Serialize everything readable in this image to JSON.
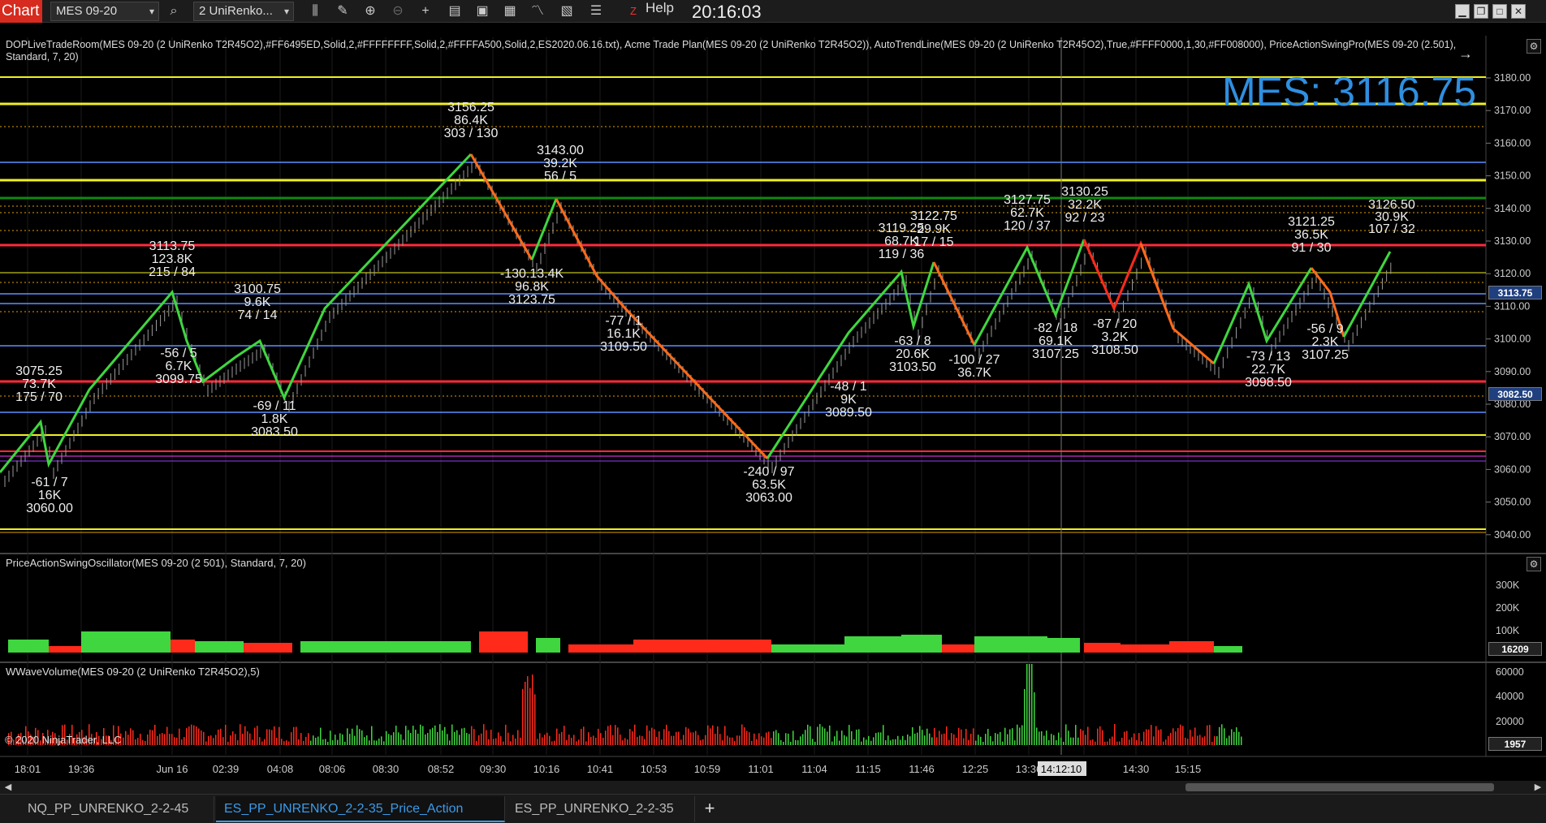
{
  "toolbar": {
    "chart_label": "Chart",
    "instrument": "MES 09-20",
    "bar_type": "2 UniRenko...",
    "help": "Help",
    "clock": "20:16:03"
  },
  "indicator_header": "DOPLiveTradeRoom(MES 09-20 (2 UniRenko T2R45O2),#FF6495ED,Solid,2,#FFFFFFFF,Solid,2,#FFFFA500,Solid,2,ES2020.06.16.txt), Acme Trade Plan(MES 09-20 (2 UniRenko T2R45O2)), AutoTrendLine(MES 09-20 (2 UniRenko T2R45O2),True,#FFFF0000,1,30,#FF008000), PriceActionSwingPro(MES 09-20 (2.501), Standard, 7, 20)",
  "big_price": "MES: 3116.75",
  "price_axis": [
    "3180.00",
    "3170.00",
    "3160.00",
    "3150.00",
    "3140.00",
    "3130.00",
    "3120.00",
    "3110.00",
    "3100.00",
    "3090.00",
    "3080.00",
    "3070.00",
    "3060.00",
    "3050.00",
    "3040.00"
  ],
  "price_tags": [
    {
      "label": "3113.75",
      "color": "#1f3f7f"
    },
    {
      "label": "3082.50",
      "color": "#1f3f7f"
    }
  ],
  "oscillator": {
    "title": "PriceActionSwingOscillator(MES 09-20 (2 501), Standard, 7, 20)",
    "axis": [
      "300K",
      "200K",
      "100K"
    ],
    "last": "16209"
  },
  "volume": {
    "title": "WWaveVolume(MES 09-20 (2 UniRenko T2R45O2),5)",
    "axis": [
      "60000",
      "40000",
      "20000"
    ],
    "last": "1957"
  },
  "copyright": "© 2020 NinjaTrader, LLC",
  "time_axis": [
    "18:01",
    "19:36",
    "Jun 16",
    "02:39",
    "04:08",
    "08:06",
    "08:30",
    "08:52",
    "09:30",
    "10:16",
    "10:41",
    "10:53",
    "10:59",
    "11:01",
    "11:04",
    "11:15",
    "11:46",
    "12:25",
    "13:36",
    "14:12:10",
    "14:30",
    "15:15"
  ],
  "swing_labels": [
    {
      "t": [
        "3075.25",
        "73.7K",
        "175 / 70"
      ]
    },
    {
      "t": [
        "3113.75",
        "123.8K",
        "215 / 84"
      ]
    },
    {
      "t": [
        "3100.75",
        "9.6K",
        "74 / 14"
      ]
    },
    {
      "t": [
        "3156.25",
        "86.4K",
        "303 / 130"
      ]
    },
    {
      "t": [
        "3143.00",
        "39.2K",
        "56 / 5"
      ]
    },
    {
      "t": [
        "-130.13.4K",
        "96.8K",
        "3123.75"
      ]
    },
    {
      "t": [
        "-61 / 7",
        "16K",
        "3060.00"
      ]
    },
    {
      "t": [
        "-56 / 5",
        "6.7K",
        "3099.75"
      ]
    },
    {
      "t": [
        "-69 / 11",
        "1.8K",
        "3083.50"
      ]
    },
    {
      "t": [
        "-240 / 97",
        "63.5K",
        "3063.00"
      ]
    },
    {
      "t": [
        "-48 / 1",
        "9K",
        "3089.50"
      ]
    },
    {
      "t": [
        "-63 / 8",
        "20.6K",
        "3103.50"
      ]
    },
    {
      "t": [
        "3119.25",
        "68.7K",
        "119 / 36"
      ]
    },
    {
      "t": [
        "3122.75",
        "29.9K",
        "17 / 15"
      ]
    },
    {
      "t": [
        "3127.75",
        "62.7K",
        "120 / 37"
      ]
    },
    {
      "t": [
        "3130.25",
        "32.2K",
        "92 / 23"
      ]
    },
    {
      "t": [
        "-82 / 18",
        "69.1K",
        "3107.25"
      ]
    },
    {
      "t": [
        "-87 / 20",
        "3.2K",
        "3108.50"
      ]
    },
    {
      "t": [
        "-100 / 27",
        "36.7K"
      ]
    },
    {
      "t": [
        "3121.25",
        "36.5K",
        "91 / 30"
      ]
    },
    {
      "t": [
        "3126.50",
        "30.9K",
        "107 / 32"
      ]
    },
    {
      "t": [
        "-73 / 13",
        "22.7K",
        "3098.50"
      ]
    },
    {
      "t": [
        "-56 / 9",
        "2.3K",
        "3107.25"
      ]
    },
    {
      "t": [
        "-77 / 1",
        "16.1K",
        "3109.50"
      ]
    }
  ],
  "tabs": [
    {
      "label": "NQ_PP_UNRENKO_2-2-45"
    },
    {
      "label": "ES_PP_UNRENKO_2-2-35_Price_Action"
    },
    {
      "label": "ES_PP_UNRENKO_2-2-35"
    }
  ],
  "add_tab": "+",
  "colors": {
    "up": "#3fd63f",
    "down": "#ff2a1a",
    "swing_down": "#ff6a1a",
    "accent": "#2f8fe0",
    "chart_tab": "#d62b1e"
  }
}
